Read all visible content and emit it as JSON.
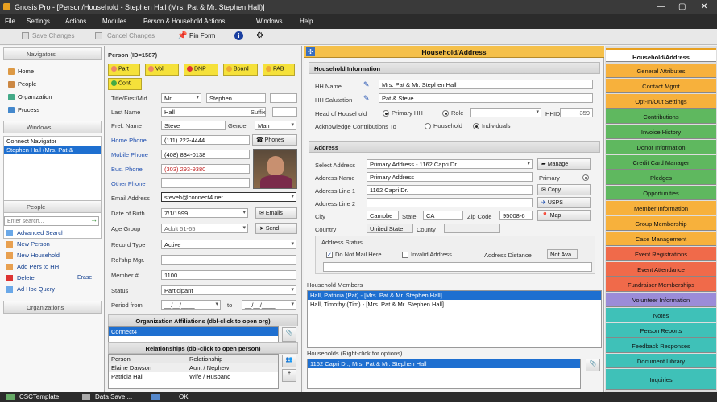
{
  "window": {
    "title": "Gnosis Pro - [Person/Household - Stephen Hall (Mrs. Pat & Mr. Stephen Hall)]",
    "min": "—",
    "max": "▢",
    "close": "✕"
  },
  "menu": [
    "File",
    "Settings",
    "Actions",
    "Modules",
    "Person & Household Actions",
    "Windows",
    "Help"
  ],
  "toolbar": {
    "save": "Save Changes",
    "cancel": "Cancel Changes",
    "pin": "Pin Form"
  },
  "navigators": {
    "header": "Navigators",
    "items": [
      "Home",
      "People",
      "Organization",
      "Process"
    ]
  },
  "windows": {
    "header": "Windows",
    "items": [
      "Connect Navigator",
      "Stephen Hall (Mrs. Pat &"
    ]
  },
  "people": {
    "header": "People",
    "search_placeholder": "Enter search...",
    "items": [
      "Advanced Search",
      "New Person",
      "New Household",
      "Add Pers to HH",
      "Delete",
      "Ad Hoc Query"
    ],
    "erase": "Erase"
  },
  "organizations": {
    "header": "Organizations"
  },
  "person": {
    "id_label": "Person (ID=1587)",
    "buttons": [
      "Part",
      "Vol",
      "DNP",
      "Board",
      "PAB",
      "Cont."
    ],
    "labels": {
      "title_first_mid": "Title/First/Mid",
      "last_name": "Last Name",
      "suffix": "Suffix",
      "pref_name": "Pref. Name",
      "gender": "Gender",
      "home_phone": "Home Phone",
      "mobile_phone": "Mobile Phone",
      "bus_phone": "Bus. Phone",
      "other_phone": "Other Phone",
      "email": "Email Address",
      "dob": "Date of Birth",
      "age_group": "Age Group",
      "record_type": "Record Type",
      "relship": "Rel'shp Mgr.",
      "member": "Member #",
      "status": "Status",
      "period_from": "Period  from",
      "to": "to"
    },
    "values": {
      "title": "Mr.",
      "first": "Stephen",
      "last": "Hall",
      "pref": "Steve",
      "gender": "Man",
      "home": "(111) 222-4444",
      "mobile": "(408) 834-0138",
      "bus": "(303) 293-9380",
      "email": "steveh@connect4.net",
      "dob": "7/1/1999",
      "age_group": "Adult 51-65",
      "record_type": "Active",
      "member": "1100",
      "status": "Participant",
      "period_from": "__/__/____",
      "period_to": "__/__/____"
    },
    "side_buttons": {
      "phones": "Phones",
      "emails": "Emails",
      "send": "Send"
    },
    "org_aff_header": "Organization Affiliations (dbl-click to open org)",
    "org_aff": [
      "Connect4"
    ],
    "rel_header": "Relationships (dbl-click to open person)",
    "rel_cols": [
      "Person",
      "Relationship"
    ],
    "rels": [
      [
        "Elaine Dawson",
        "Aunt / Nephew"
      ],
      [
        "Patricia Hall",
        "Wife / Husband"
      ]
    ]
  },
  "household": {
    "header": "Household/Address",
    "info_header": "Household Information",
    "labels": {
      "hh_name": "HH Name",
      "hh_salutation": "HH Salutation",
      "head": "Head of Household",
      "primary_hh": "Primary HH",
      "role": "Role",
      "hhid": "HHID",
      "ack": "Acknowledge Contributions To",
      "household": "Household",
      "individuals": "Individuals"
    },
    "values": {
      "hh_name": "Mrs. Pat & Mr. Stephen Hall",
      "hh_salutation": "Pat & Steve",
      "hhid": "359"
    },
    "address_header": "Address",
    "addr_labels": {
      "select": "Select Address",
      "name": "Address Name",
      "line1": "Address Line 1",
      "line2": "Address Line 2",
      "city": "City",
      "state": "State",
      "zip": "Zip Code",
      "country": "Country",
      "county": "County",
      "primary": "Primary"
    },
    "addr_values": {
      "select": "Primary Address - 1162 Capri Dr.",
      "name": "Primary Address",
      "line1": "1162 Capri Dr.",
      "line2": "",
      "city": "Campbe",
      "state": "CA",
      "zip": "95008-6",
      "country": "United State"
    },
    "addr_buttons": {
      "manage": "Manage",
      "copy": "Copy",
      "usps": "USPS",
      "map": "Map"
    },
    "status_header": "Address Status",
    "status": {
      "dnmh": "Do Not Mail Here",
      "invalid": "Invalid Address",
      "distance": "Address Distance",
      "distance_val": "Not Ava"
    },
    "members_header": "Household Members",
    "members": [
      "Hall, Patricia (Pat)  -  [Mrs. Pat & Mr. Stephen Hall]",
      "Hall, Timothy (Tim)  -  [Mrs. Pat & Mr. Stephen Hall]"
    ],
    "households_header": "Households (Right-click for options)",
    "households": [
      "1162 Capri Dr., Mrs. Pat & Mr. Stephen Hall"
    ]
  },
  "tabs": [
    {
      "label": "Household/Address",
      "color": "#ffffff"
    },
    {
      "label": "General Attributes",
      "color": "#f7b13c"
    },
    {
      "label": "Contact Mgmt",
      "color": "#f7b13c"
    },
    {
      "label": "Opt-In/Out Settings",
      "color": "#f7b13c"
    },
    {
      "label": "Contributions",
      "color": "#5fb85f"
    },
    {
      "label": "Invoice History",
      "color": "#5fb85f"
    },
    {
      "label": "Donor Information",
      "color": "#5fb85f"
    },
    {
      "label": "Credit Card Manager",
      "color": "#5fb85f"
    },
    {
      "label": "Pledges",
      "color": "#5fb85f"
    },
    {
      "label": "Opportunities",
      "color": "#5fb85f"
    },
    {
      "label": "Member Information",
      "color": "#f7b13c"
    },
    {
      "label": "Group Membership",
      "color": "#f7b13c"
    },
    {
      "label": "Case Management",
      "color": "#f7b13c"
    },
    {
      "label": "Event Registrations",
      "color": "#f06a4a"
    },
    {
      "label": "Event Attendance",
      "color": "#f06a4a"
    },
    {
      "label": "Fundraiser Memberships",
      "color": "#f06a4a"
    },
    {
      "label": "Volunteer Information",
      "color": "#9b8cd8"
    },
    {
      "label": "Notes",
      "color": "#3fc1b8"
    },
    {
      "label": "Person Reports",
      "color": "#3fc1b8"
    },
    {
      "label": "Feedback Responses",
      "color": "#3fc1b8"
    },
    {
      "label": "Document Library",
      "color": "#3fc1b8"
    },
    {
      "label": "Inquiries",
      "color": "#3fc1b8"
    }
  ],
  "status": {
    "template": "CSCTemplate",
    "data_save": "Data Save ...",
    "ok": "OK"
  }
}
